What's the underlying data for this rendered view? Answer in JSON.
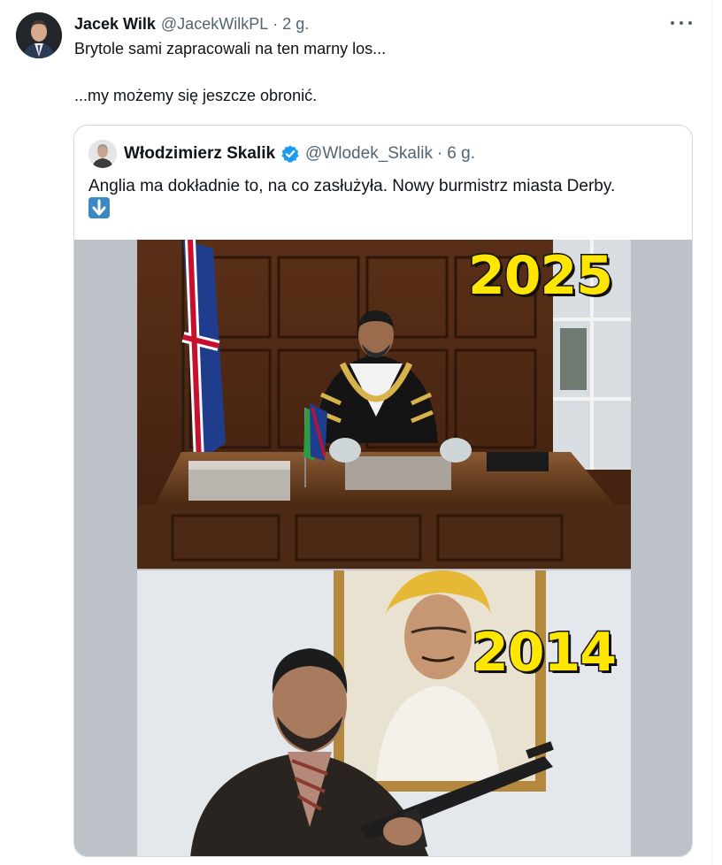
{
  "post": {
    "author_name": "Jacek Wilk",
    "author_handle": "@JacekWilkPL",
    "separator": "·",
    "time": "2 g.",
    "text_line_1": "Brytole sami zapracowali na ten marny los...",
    "text_line_2": "...my możemy się jeszcze obronić.",
    "more_icon": "more-horizontal-icon"
  },
  "quote": {
    "author_name": "Włodzimierz Skalik",
    "verified": true,
    "verified_color": "#1d9bf0",
    "author_handle": "@Wlodek_Skalik",
    "separator": "·",
    "time": "6 g.",
    "text_line_1": "Anglia ma dokładnie to, na co zasłużyła. Nowy burmistrz miasta Derby.",
    "emoji": "down-arrow-emoji",
    "media": {
      "top_label": "2025",
      "bottom_label": "2014"
    }
  },
  "colors": {
    "text_primary": "#0f1419",
    "text_secondary": "#536471",
    "border": "#cfd9de",
    "year_label": "#ffe600"
  }
}
